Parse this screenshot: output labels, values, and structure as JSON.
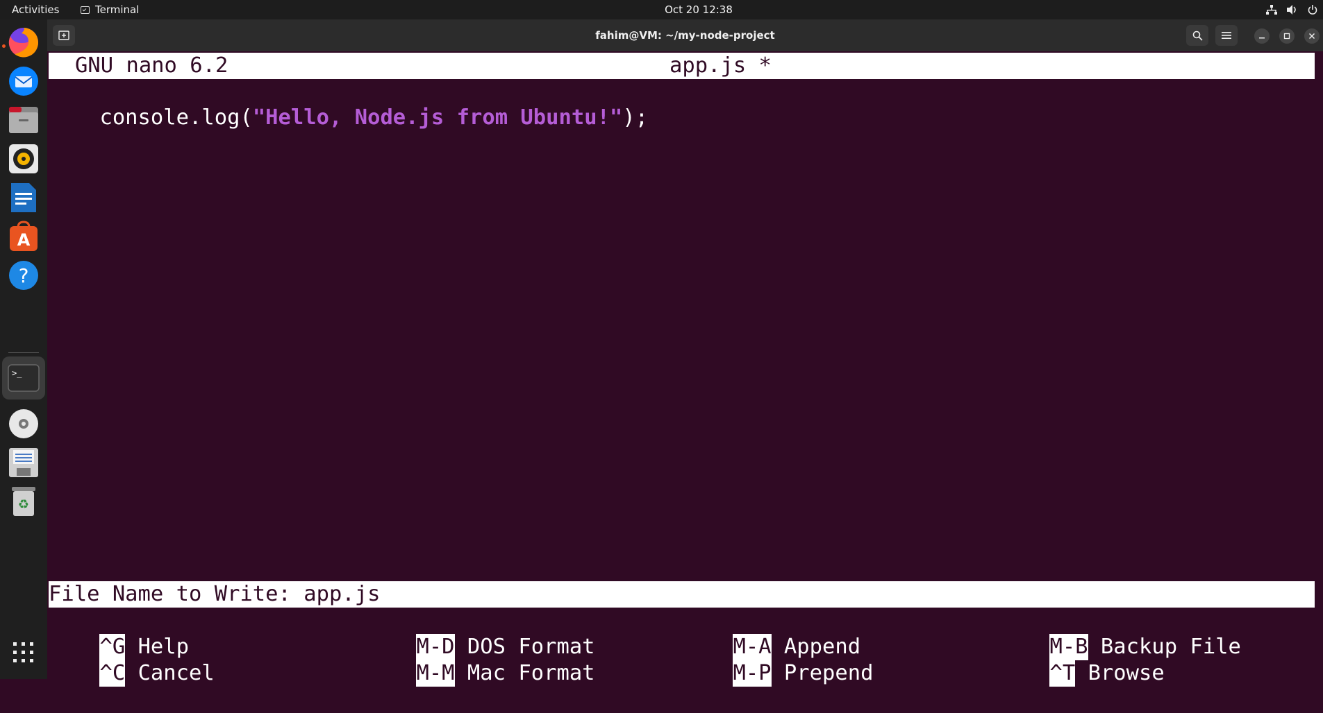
{
  "topbar": {
    "activities": "Activities",
    "app_name": "Terminal",
    "clock": "Oct 20  12:38"
  },
  "window": {
    "title": "fahim@VM: ~/my-node-project"
  },
  "nano": {
    "version": "GNU nano 6.2",
    "filename": "app.js *",
    "code": {
      "prefix": "console.log(",
      "string": "\"Hello, Node.js from Ubuntu!\"",
      "suffix": ");"
    },
    "prompt": "File Name to Write: app.js",
    "shortcuts": [
      {
        "key": "^G",
        "label": "Help"
      },
      {
        "key": "M-D",
        "label": "DOS Format"
      },
      {
        "key": "M-A",
        "label": "Append"
      },
      {
        "key": "M-B",
        "label": "Backup File"
      },
      {
        "key": "^C",
        "label": "Cancel"
      },
      {
        "key": "M-M",
        "label": "Mac Format"
      },
      {
        "key": "M-P",
        "label": "Prepend"
      },
      {
        "key": "^T",
        "label": "Browse"
      }
    ]
  },
  "dock": [
    "firefox-icon",
    "thunderbird-icon",
    "files-icon",
    "rhythmbox-icon",
    "writer-icon",
    "app-center-icon",
    "help-icon",
    "terminal-icon",
    "disc-icon",
    "floppy-icon",
    "trash-icon",
    "app-grid-icon"
  ],
  "colors": {
    "terminal_bg": "#300a24",
    "string_purple": "#b55dd6",
    "accent_orange": "#e95420"
  }
}
